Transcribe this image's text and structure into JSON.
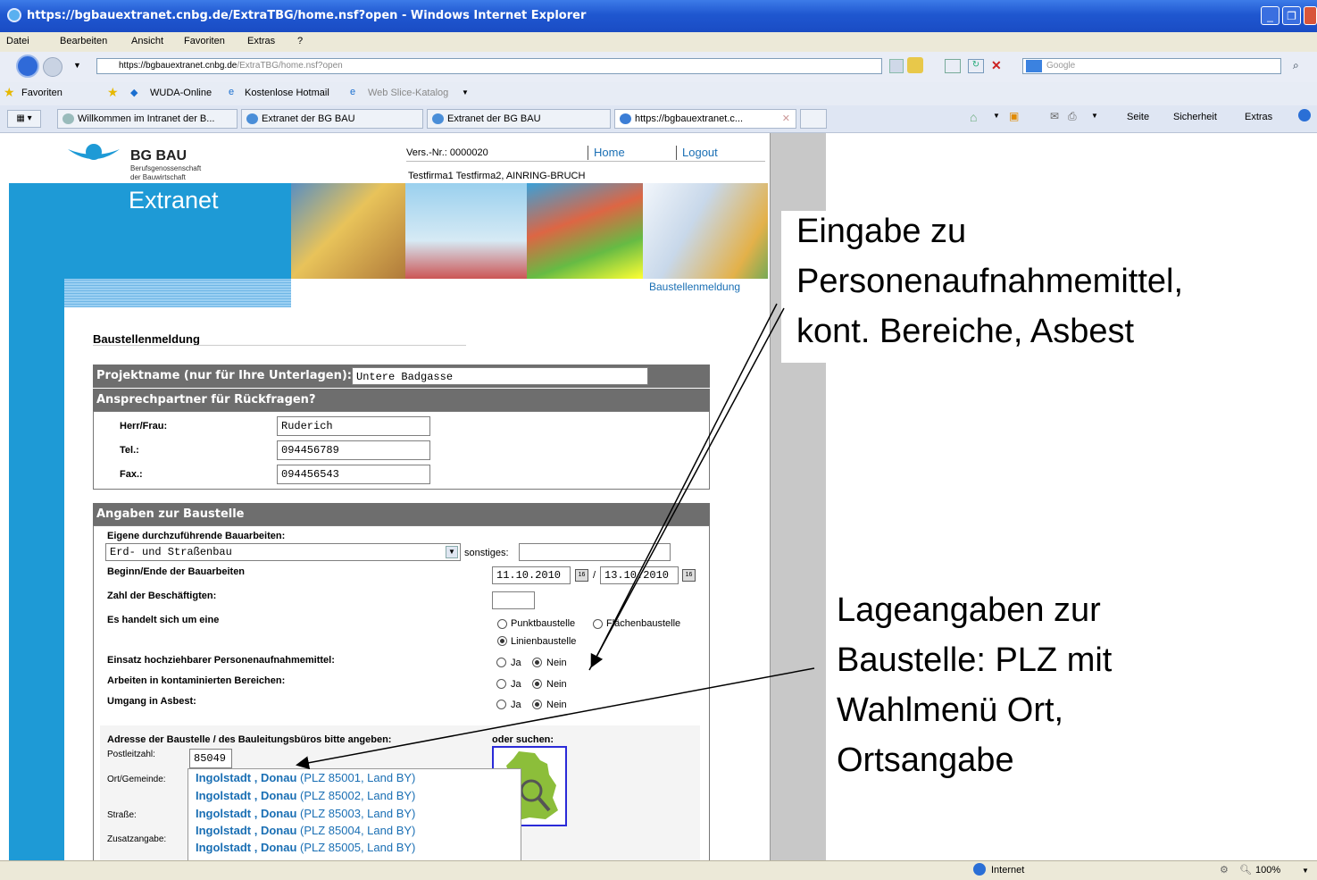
{
  "window": {
    "title": "https://bgbauextranet.cnbg.de/ExtraTBG/home.nsf?open - Windows Internet Explorer"
  },
  "menu": [
    "Datei",
    "Bearbeiten",
    "Ansicht",
    "Favoriten",
    "Extras",
    "?"
  ],
  "address": {
    "prefix": "https://bgbauextranet.",
    "domain": "cnbg.de",
    "path": "/ExtraTBG/home.nsf?open",
    "search_placeholder": "Google"
  },
  "favorites": {
    "label": "Favoriten",
    "items": [
      "WUDA-Online",
      "Kostenlose Hotmail",
      "Web Slice-Katalog"
    ]
  },
  "tabs": [
    "Willkommen im Intranet der B...",
    "Extranet der BG BAU",
    "Extranet der BG BAU",
    "https://bgbauextranet.c..."
  ],
  "commandbar": [
    "Seite",
    "Sicherheit",
    "Extras"
  ],
  "header": {
    "brand": "BG BAU",
    "brand_sub1": "Berufsgenossenschaft",
    "brand_sub2": "der Bauwirtschaft",
    "extranet": "Extranet",
    "vers": "Vers.-Nr.: 0000020",
    "home": "Home",
    "logout": "Logout",
    "company": "Testfirma1 Testfirma2, AINRING-BRUCH",
    "nav_current": "Baustellenmeldung"
  },
  "form": {
    "heading": "Baustellenmeldung",
    "projekt_label": "Projektname (nur für Ihre Unterlagen):",
    "projekt_value": "Untere Badgasse",
    "ansprech_heading": "Ansprechpartner für Rückfragen?",
    "herr_label": "Herr/Frau:",
    "herr_value": "Ruderich",
    "tel_label": "Tel.:",
    "tel_value": "094456789",
    "fax_label": "Fax.:",
    "fax_value": "094456543",
    "baustelle_heading": "Angaben zur Baustelle",
    "eigene_label": "Eigene durchzuführende Bauarbeiten:",
    "eigene_value": "Erd- und Straßenbau",
    "sonstiges_label": "sonstiges:",
    "beginn_label": "Beginn/Ende der Bauarbeiten",
    "beginn_value": "11.10.2010",
    "ende_value": "13.10.2010",
    "date_sep": "/",
    "zahl_label": "Zahl der Beschäftigten:",
    "art_label": "Es handelt sich um eine",
    "art_options": [
      "Punktbaustelle",
      "Flächenbaustelle",
      "Linienbaustelle"
    ],
    "einsatz_label": "Einsatz hochziehbarer Personenaufnahmemittel:",
    "kontam_label": "Arbeiten in kontaminierten Bereichen:",
    "asbest_label": "Umgang in Asbest:",
    "ja": "Ja",
    "nein": "Nein",
    "adresse_label": "Adresse der Baustelle / des Bauleitungsbüros bitte angeben:",
    "suchen_label": "oder suchen:",
    "plz_label": "Postleitzahl:",
    "plz_value": "85049",
    "ort_label": "Ort/Gemeinde:",
    "strasse_label": "Straße:",
    "zusatz_label": "Zusatzangabe:",
    "suggestions": [
      {
        "city": "Ingolstadt , Donau",
        "meta": "(PLZ 85001, Land BY)"
      },
      {
        "city": "Ingolstadt , Donau",
        "meta": "(PLZ 85002, Land BY)"
      },
      {
        "city": "Ingolstadt , Donau",
        "meta": "(PLZ 85003, Land BY)"
      },
      {
        "city": "Ingolstadt , Donau",
        "meta": "(PLZ 85004, Land BY)"
      },
      {
        "city": "Ingolstadt , Donau",
        "meta": "(PLZ 85005, Land BY)"
      }
    ]
  },
  "annotations": {
    "top": [
      "Eingabe zu",
      "Personenaufnahmemittel,",
      "kont. Bereiche, Asbest"
    ],
    "bottom": [
      "Lageangaben zur",
      "Baustelle: PLZ mit",
      "Wahlmenü Ort,",
      "Ortsangabe"
    ]
  },
  "status": {
    "zone": "Internet",
    "zoom": "100%"
  },
  "colors": {
    "titlebar": "#1f57d0",
    "brand_blue": "#1e9ad6",
    "section_gray": "#6e6e6e",
    "suggest_link": "#1a6fb4"
  }
}
